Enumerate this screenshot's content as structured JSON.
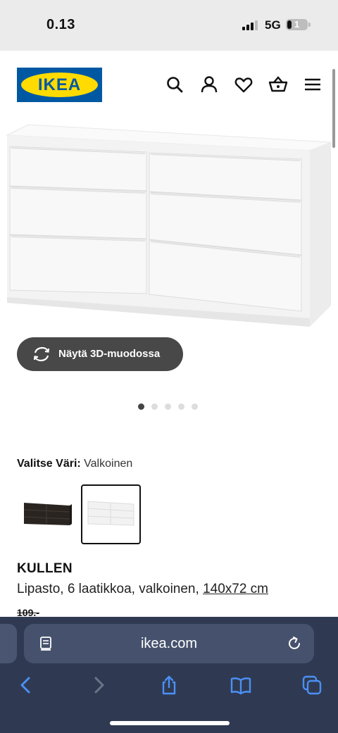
{
  "status": {
    "time": "0.13",
    "network": "5G",
    "battery": "1"
  },
  "header": {
    "logo_text": "IKEA",
    "icons": [
      "search-icon",
      "user-icon",
      "heart-icon",
      "cart-icon",
      "menu-icon"
    ]
  },
  "gallery": {
    "view_3d_label": "Näytä 3D-muodossa",
    "dot_count": 5,
    "active_dot": 1
  },
  "color": {
    "label": "Valitse Väri:",
    "value": "Valkoinen",
    "swatches": [
      {
        "name": "black-brown",
        "hex": "#2a2420",
        "selected": false
      },
      {
        "name": "white",
        "hex": "#f4f4f4",
        "selected": true
      }
    ]
  },
  "product": {
    "name": "KULLEN",
    "description": "Lipasto, 6 laatikkoa, valkoinen,",
    "size": "140x72 cm",
    "old_price": "109.-"
  },
  "browser": {
    "url": "ikea.com"
  },
  "colors": {
    "ikea_blue": "#0058a3",
    "ikea_yellow": "#ffdb00",
    "browser_bg": "#2f3a52",
    "accent": "#4b8ff5"
  }
}
